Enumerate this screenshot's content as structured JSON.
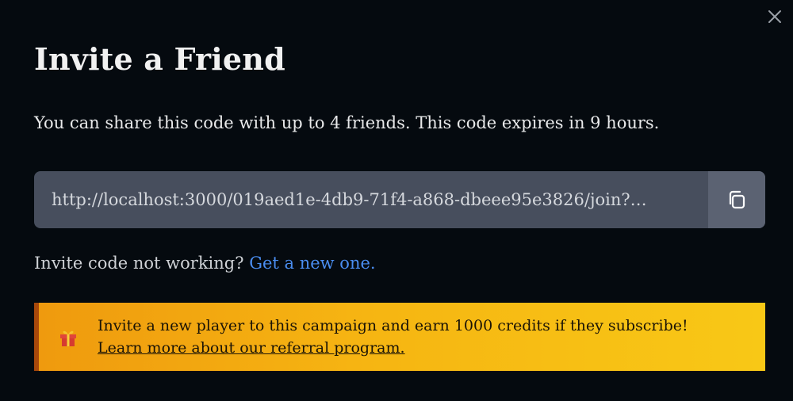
{
  "dialog": {
    "title": "Invite a Friend",
    "description": "You can share this code with up to 4 friends. This code expires in 9 hours.",
    "close_icon": "close-icon"
  },
  "invite": {
    "link": "http://localhost:3000/019aed1e-4db9-71f4-a868-dbeee95e3826/join?…",
    "copy_icon": "copy-icon"
  },
  "help": {
    "text": "Invite code not working?",
    "link_label": "Get a new one."
  },
  "referral": {
    "icon": "gift-icon",
    "message": "Invite a new player to this campaign and earn 1000 credits if they subscribe!",
    "link_label": "Learn more about our referral program."
  },
  "colors": {
    "background": "#050a0f",
    "link_accent": "#4a8df0",
    "banner_start": "#ef9a0e",
    "banner_end": "#f8c816",
    "banner_border": "#a8480b"
  }
}
